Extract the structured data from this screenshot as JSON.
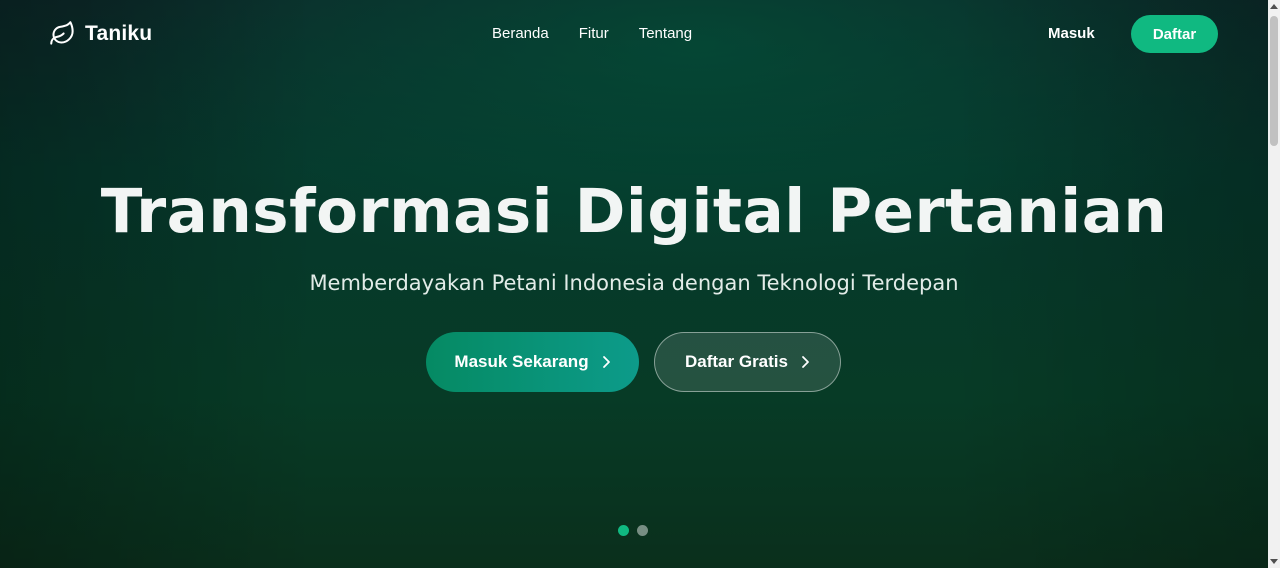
{
  "brand": {
    "name": "Taniku",
    "icon": "leaf-icon"
  },
  "nav": {
    "items": [
      {
        "label": "Beranda"
      },
      {
        "label": "Fitur"
      },
      {
        "label": "Tentang"
      }
    ],
    "login_label": "Masuk",
    "register_label": "Daftar"
  },
  "hero": {
    "title": "Transformasi Digital Pertanian",
    "subtitle": "Memberdayakan Petani Indonesia dengan Teknologi Terdepan",
    "primary_cta": "Masuk Sekarang",
    "secondary_cta": "Daftar Gratis",
    "cta_icon": "chevron-right-icon"
  },
  "carousel": {
    "slide_count": 2,
    "active_slide": 1
  },
  "colors": {
    "accent": "#10b981",
    "background_dark": "#06382c",
    "text": "#ffffff"
  }
}
